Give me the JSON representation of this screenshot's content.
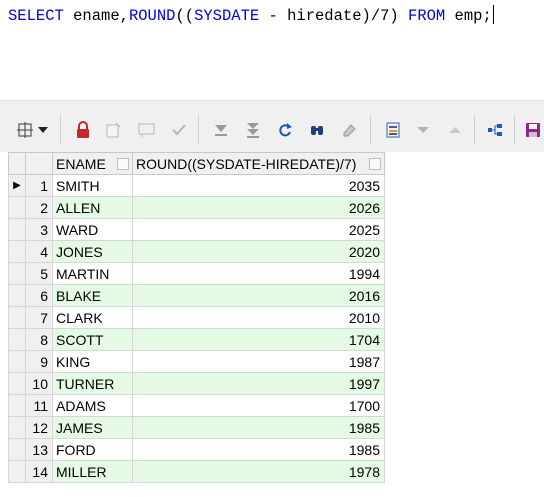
{
  "editor": {
    "sql_select": "SELECT",
    "sql_ename": " ename,",
    "sql_round": "ROUND",
    "sql_open": "((",
    "sql_sysdate": "SYSDATE",
    "sql_minus": " - ",
    "sql_hiredate": "hiredate",
    "sql_div": ")/7) ",
    "sql_from": "FROM",
    "sql_emp": " emp;"
  },
  "toolbar": {
    "icons": [
      "grid-options-icon",
      "dropdown-chevron-icon",
      "lock-icon",
      "new-record-icon",
      "comment-icon",
      "check-icon",
      "fetch-next-icon",
      "fetch-last-icon",
      "refresh-icon",
      "find-icon",
      "clear-icon",
      "save-to-file-icon",
      "sort-desc-icon",
      "sort-asc-icon",
      "query-tree-icon",
      "save-icon"
    ]
  },
  "grid": {
    "columns": [
      "ENAME",
      "ROUND((SYSDATE-HIREDATE)/7)"
    ],
    "current_row_marker": "▶",
    "rows": [
      {
        "n": "1",
        "ename": "SMITH",
        "value": "2035"
      },
      {
        "n": "2",
        "ename": "ALLEN",
        "value": "2026"
      },
      {
        "n": "3",
        "ename": "WARD",
        "value": "2025"
      },
      {
        "n": "4",
        "ename": "JONES",
        "value": "2020"
      },
      {
        "n": "5",
        "ename": "MARTIN",
        "value": "1994"
      },
      {
        "n": "6",
        "ename": "BLAKE",
        "value": "2016"
      },
      {
        "n": "7",
        "ename": "CLARK",
        "value": "2010"
      },
      {
        "n": "8",
        "ename": "SCOTT",
        "value": "1704"
      },
      {
        "n": "9",
        "ename": "KING",
        "value": "1987"
      },
      {
        "n": "10",
        "ename": "TURNER",
        "value": "1997"
      },
      {
        "n": "11",
        "ename": "ADAMS",
        "value": "1700"
      },
      {
        "n": "12",
        "ename": "JAMES",
        "value": "1985"
      },
      {
        "n": "13",
        "ename": "FORD",
        "value": "1985"
      },
      {
        "n": "14",
        "ename": "MILLER",
        "value": "1978"
      }
    ]
  },
  "colors": {
    "keyword": "#0000e0",
    "alt_row": "#e4fae4",
    "lock": "#c0282a",
    "save": "#8a2b8a"
  }
}
